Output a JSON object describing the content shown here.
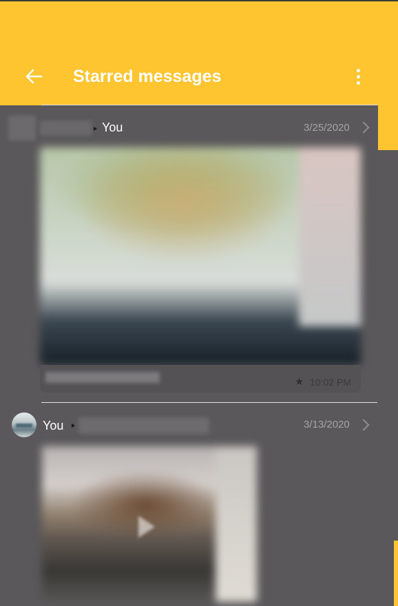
{
  "header": {
    "title": "Starred messages",
    "back_icon": "arrow-left-icon",
    "menu_icon": "more-vertical-icon",
    "background_color": "#fec531"
  },
  "messages": [
    {
      "sender": "",
      "recipient": "You",
      "date": "3/25/2020",
      "caption": "",
      "time": "10:02 PM",
      "starred": true,
      "media": "image"
    },
    {
      "sender": "You",
      "recipient": "",
      "date": "3/13/2020",
      "media": "video"
    }
  ],
  "icons": {
    "star": "★",
    "chevron": "chevron-right-icon"
  }
}
